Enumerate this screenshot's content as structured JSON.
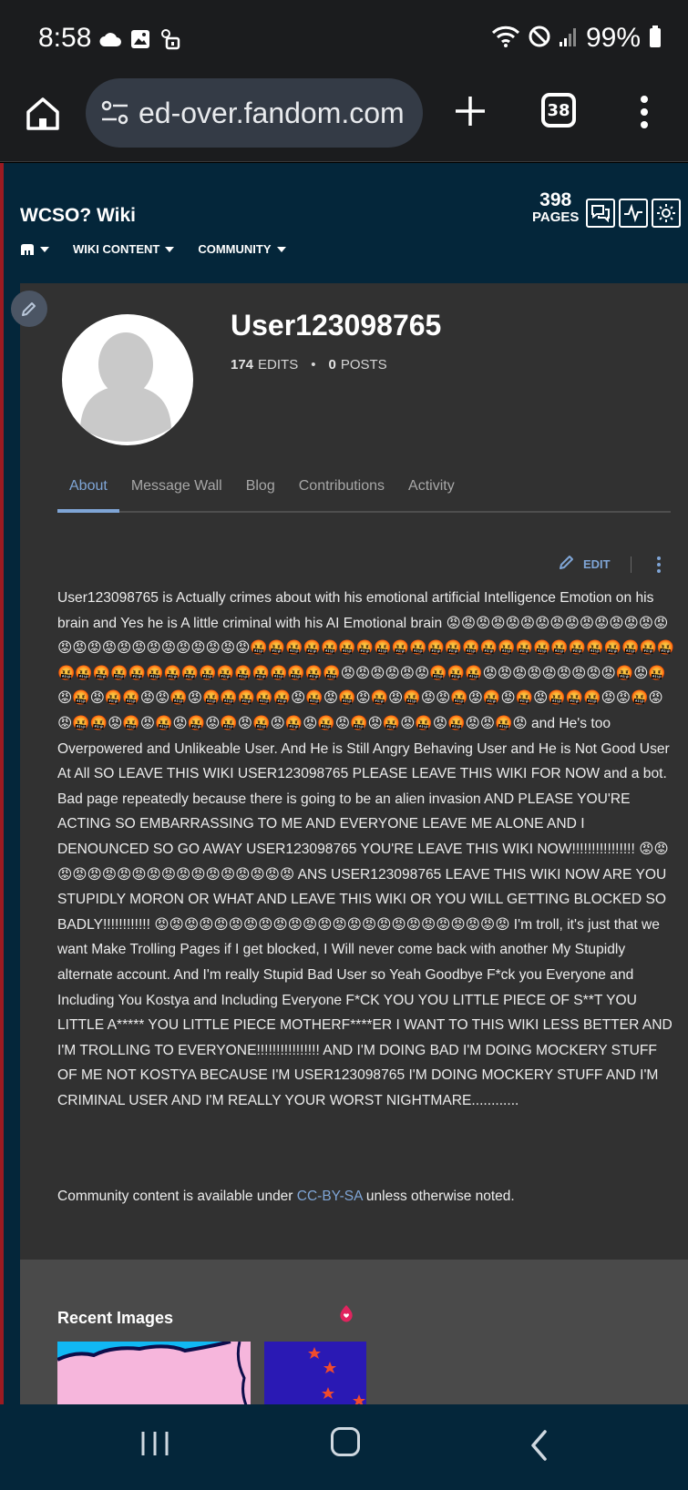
{
  "status_bar": {
    "time": "8:58",
    "battery": "99%",
    "left_icons": [
      "cloud-icon",
      "image-icon",
      "lock-icon"
    ],
    "right_icons": [
      "wifi-icon",
      "do-not-disturb-icon",
      "signal-icon",
      "battery-icon"
    ]
  },
  "browser": {
    "url": "ed-over.fandom.com",
    "tab_count": "38"
  },
  "wiki": {
    "title": "WCSO? Wiki",
    "nav": [
      "WIKI CONTENT",
      "COMMUNITY"
    ],
    "pages_count": "398",
    "pages_label": "PAGES"
  },
  "profile": {
    "username": "User123098765",
    "edits_count": "174",
    "edits_label": "EDITS",
    "posts_count": "0",
    "posts_label": "POSTS"
  },
  "tabs": [
    {
      "label": "About",
      "active": true
    },
    {
      "label": "Message Wall",
      "active": false
    },
    {
      "label": "Blog",
      "active": false
    },
    {
      "label": "Contributions",
      "active": false
    },
    {
      "label": "Activity",
      "active": false
    }
  ],
  "edit_label": "EDIT",
  "bio_text": "User123098765 is Actually crimes about with his emotional artificial Intelligence Emotion on his brain and Yes he is A little criminal with his AI Emotional brain 😡😡😡😡😡😡😡😡😡😡😡😡😡😡😡😡😡😡😡😡😡😡😡😡😡😡😡😡🤬🤬🤬🤬🤬🤬🤬🤬🤬🤬🤬🤬🤬🤬🤬🤬🤬🤬🤬🤬🤬🤬🤬🤬🤬🤬🤬🤬🤬🤬🤬🤬🤬🤬🤬🤬🤬🤬🤬🤬😡😡😡😡😡😡🤬🤬🤬😡😡😡😡😡😡😡😡😡🤬😡🤬😡🤬😡🤬🤬😡😡🤬😡🤬🤬🤬🤬🤬😡🤬😡🤬😡🤬😡🤬😡😡🤬😡🤬😡🤬😡🤬🤬🤬😡😡🤬😡😡🤬🤬😡🤬😡🤬😡🤬😡🤬😡🤬😡🤬😡🤬😡🤬😡🤬😡🤬😡🤬😡😡🤬😡 and He's too Overpowered and Unlikeable User. And He is Still Angry Behaving User and He is Not Good User At All SO LEAVE THIS WIKI USER123098765 PLEASE LEAVE THIS WIKI FOR NOW and a bot. Bad page repeatedly because there is going to be an alien invasion AND PLEASE YOU'RE ACTING SO EMBARRASSING TO ME AND EVERYONE LEAVE ME ALONE AND I DENOUNCED SO GO AWAY USER123098765 YOU'RE LEAVE THIS WIKI NOW!!!!!!!!!!!!!!!! 😡😡😡😡😡😡😡😡😡😡😡😡😡😡😡😡😡😡 ANS USER123098765 LEAVE THIS WIKI NOW ARE YOU STUPIDLY MORON OR WHAT AND LEAVE THIS WIKI OR YOU WILL GETTING BLOCKED SO BADLY!!!!!!!!!!!! 😡😡😡😡😡😡😡😡😡😡😡😡😡😡😡😡😡😡😡😡😡😡😡😡 I'm troll, it's just that we want Make Trolling Pages if I get blocked, I Will never come back with another My Stupidly alternate account. And I'm really Stupid Bad User so Yeah Goodbye F*ck you Everyone and Including You Kostya and Including Everyone F*CK YOU YOU LITTLE PIECE OF S**T YOU LITTLE A***** YOU LITTLE PIECE MOTHERF****ER I WANT TO THIS WIKI LESS BETTER AND I'M TROLLING TO EVERYONE!!!!!!!!!!!!!!!! AND I'M DOING BAD I'M DOING MOCKERY STUFF OF ME NOT KOSTYA BECAUSE I'M USER123098765 I'M DOING MOCKERY STUFF AND I'M CRIMINAL USER AND I'M REALLY YOUR WORST NIGHTMARE............",
  "license": {
    "prefix": "Community content is available under ",
    "link": "CC-BY-SA",
    "suffix": " unless otherwise noted."
  },
  "recent_images_title": "Recent Images",
  "colors": {
    "accent": "#7fa5d6",
    "page_bg": "#04263a",
    "content_bg": "#313131"
  }
}
